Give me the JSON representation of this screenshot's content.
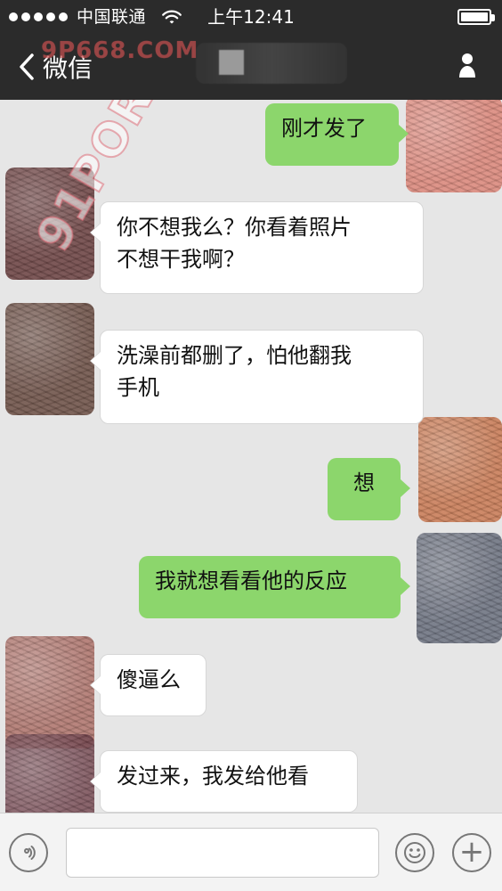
{
  "status_bar": {
    "carrier": "中国联通",
    "time": "上午12:41"
  },
  "nav": {
    "back_label": "微信",
    "title": ""
  },
  "watermarks": {
    "top": "9P668.COM",
    "diagonal": "91PORN.COM"
  },
  "chat": {
    "messages": [
      {
        "side": "right",
        "text": "刚才发了"
      },
      {
        "side": "left",
        "text": "你不想我么？你看着照片\n不想干我啊？"
      },
      {
        "side": "left",
        "text": "洗澡前都删了，怕他翻我\n手机"
      },
      {
        "side": "right",
        "text": "想"
      },
      {
        "side": "right",
        "text": "我就想看看他的反应"
      },
      {
        "side": "left",
        "text": "傻逼么"
      },
      {
        "side": "left",
        "text": "发过来，我发给他看"
      }
    ]
  },
  "input": {
    "value": "",
    "placeholder": ""
  },
  "icons": {
    "back": "chevron-left-icon",
    "profile": "profile-icon",
    "voice": "voice-icon",
    "emoji": "emoji-icon",
    "add": "plus-icon"
  },
  "colors": {
    "topbar": "#2b2b2b",
    "background": "#e6e6e6",
    "right_bubble": "#8cd66c",
    "left_bubble": "#ffffff"
  }
}
